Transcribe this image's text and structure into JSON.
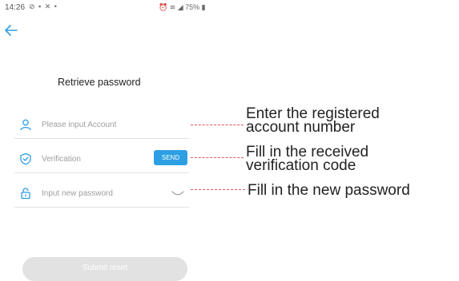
{
  "status_bar": {
    "time": "14:26",
    "left_icons": "⊘ ▪ ✕ •",
    "right_status": "⏰ ≋ ◢ 75% ▮"
  },
  "page": {
    "title": "Retrieve password"
  },
  "fields": {
    "account": {
      "placeholder": "Please input Account",
      "value": ""
    },
    "verification": {
      "placeholder": "Verification",
      "value": "",
      "send_label": "SEND"
    },
    "new_password": {
      "placeholder": "Input new password",
      "value": ""
    }
  },
  "submit": {
    "label": "Submit reset"
  },
  "annotations": {
    "account_line1": "Enter the registered",
    "account_line2": "account number",
    "verification_line1": "Fill in the received",
    "verification_line2": "verification code",
    "password": "Fill in the new password"
  },
  "colors": {
    "accent": "#2d9fe3",
    "annotation_line": "#e05a5a",
    "submit_disabled": "#e2e2e2"
  },
  "icons": {
    "back": "back-arrow-icon",
    "account": "user-icon",
    "verification": "shield-check-icon",
    "password": "lock-icon",
    "visibility": "eye-closed-icon"
  }
}
